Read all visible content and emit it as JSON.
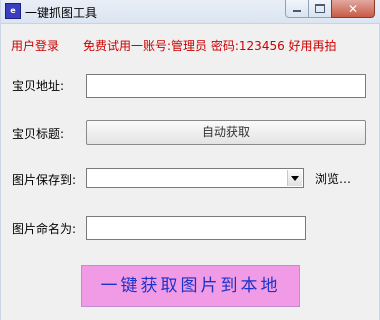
{
  "window": {
    "title": "一键抓图工具",
    "icon": "app-icon"
  },
  "header": {
    "login_link": "用户登录",
    "promo": "免费试用一账号:管理员 密码:123456 好用再拍"
  },
  "form": {
    "url_label": "宝贝地址:",
    "url_value": "",
    "title_label": "宝贝标题:",
    "auto_fetch_label": "自动获取",
    "save_label": "图片保存到:",
    "save_value": "",
    "browse_label": "浏览…",
    "name_label": "图片命名为:",
    "name_value": ""
  },
  "actions": {
    "main_button": "一键获取图片到本地"
  },
  "colors": {
    "promo_text": "#cc0000",
    "main_button_bg": "#f19ae6",
    "main_button_text": "#1b33c8"
  }
}
